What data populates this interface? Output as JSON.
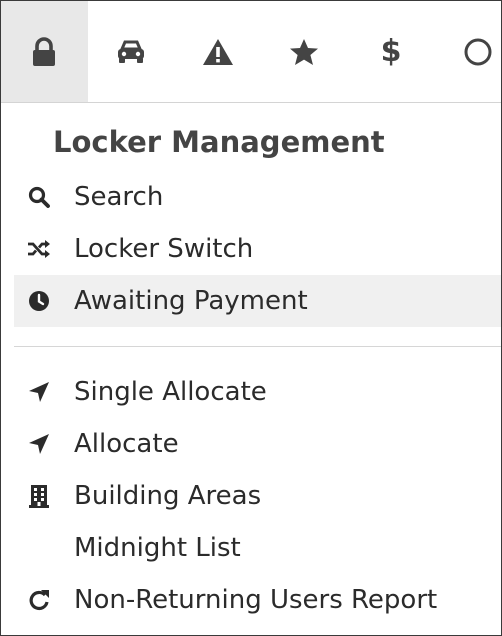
{
  "tabs": [
    {
      "icon": "lock-icon",
      "active": true
    },
    {
      "icon": "car-icon",
      "active": false
    },
    {
      "icon": "warning-icon",
      "active": false
    },
    {
      "icon": "star-icon",
      "active": false
    },
    {
      "icon": "dollar-icon",
      "glyph": "$",
      "active": false
    },
    {
      "icon": "clock-icon",
      "active": false
    }
  ],
  "menu": {
    "title": "Locker Management",
    "group1": [
      {
        "label": "Search",
        "icon": "search-icon"
      },
      {
        "label": "Locker Switch",
        "icon": "shuffle-icon"
      },
      {
        "label": "Awaiting Payment",
        "icon": "clock-icon",
        "highlighted": true
      }
    ],
    "group2": [
      {
        "label": "Single Allocate",
        "icon": "location-arrow-icon"
      },
      {
        "label": "Allocate",
        "icon": "location-arrow-icon"
      },
      {
        "label": "Building Areas",
        "icon": "building-icon"
      },
      {
        "label": "Midnight List",
        "icon": ""
      },
      {
        "label": "Non-Returning Users Report",
        "icon": "redo-icon"
      }
    ]
  },
  "colors": {
    "text": "#2b2b2b",
    "icon": "#444444",
    "active_tab_bg": "#e8e8e8",
    "hover_row_bg": "#f0f0f0",
    "divider": "#d6d6d6"
  }
}
